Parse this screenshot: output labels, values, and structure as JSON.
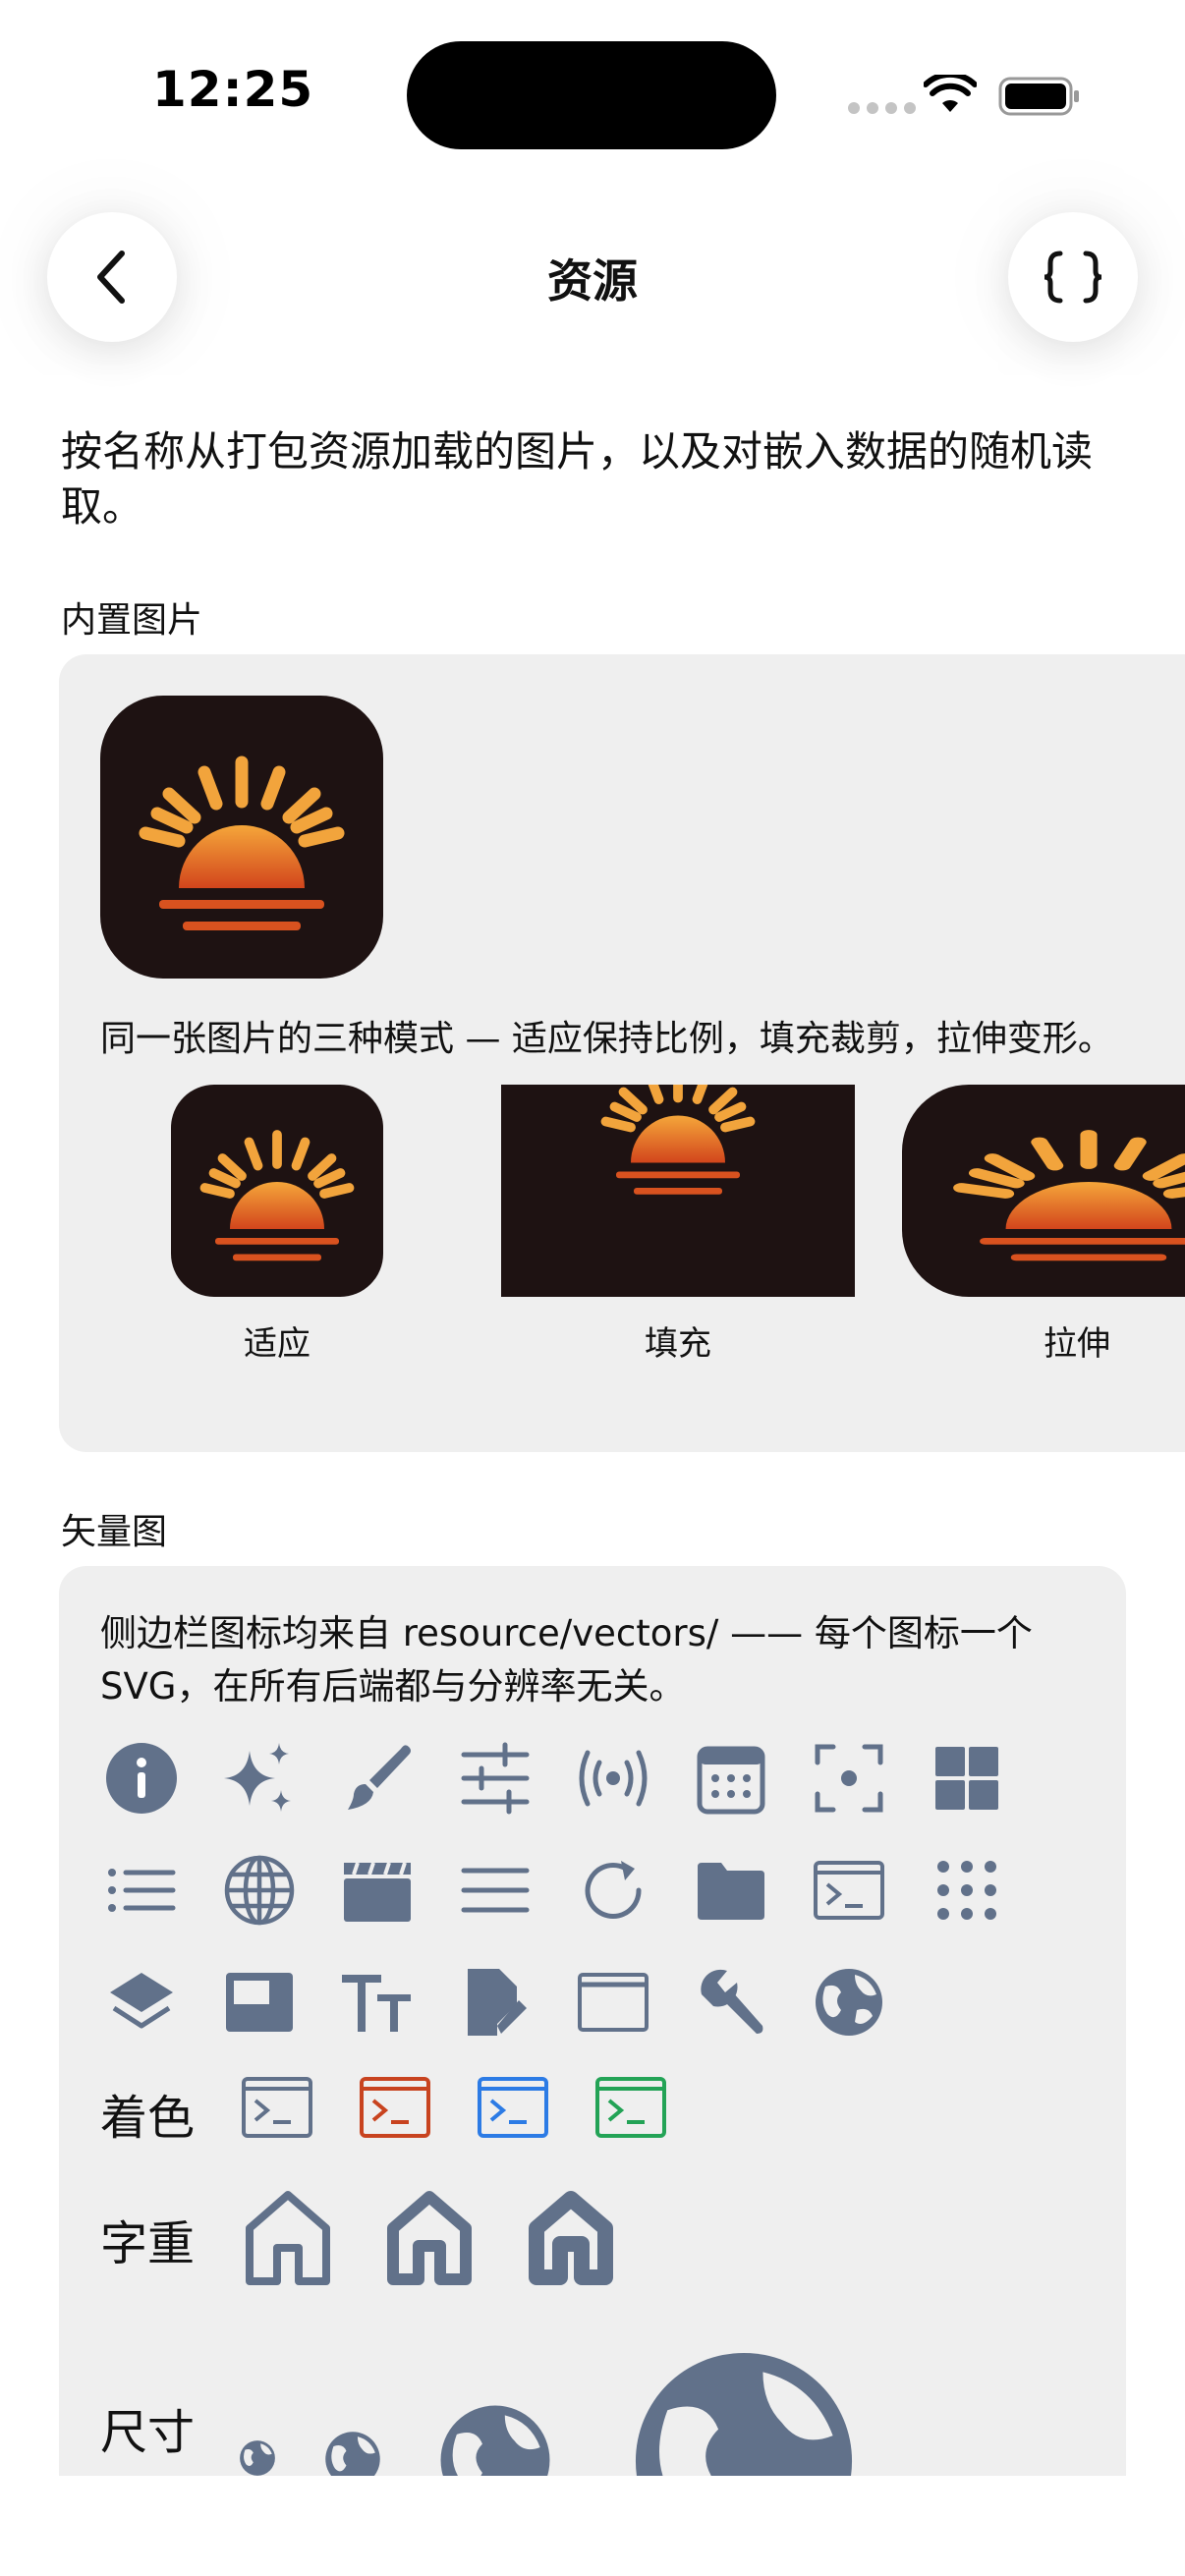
{
  "status_bar": {
    "time": "12:25"
  },
  "nav": {
    "title": "资源"
  },
  "intro": "按名称从打包资源加载的图片，以及对嵌入数据的随机读取。",
  "builtin": {
    "section_label": "内置图片",
    "modes_caption": "同一张图片的三种模式 — 适应保持比例，填充裁剪，拉伸变形。",
    "modes": [
      {
        "label": "适应"
      },
      {
        "label": "填充"
      },
      {
        "label": "拉伸"
      }
    ]
  },
  "vectors": {
    "section_label": "矢量图",
    "caption": "侧边栏图标均来自 resource/vectors/ —— 每个图标一个 SVG，在所有后端都与分辨率无关。",
    "icon_rows": [
      [
        "info-icon",
        "sparkles-icon",
        "paintbrush-icon",
        "sliders-icon",
        "broadcast-icon",
        "calendar-icon",
        "viewfinder-icon",
        "grid-icon"
      ],
      [
        "list-icon",
        "globe-icon",
        "clapperboard-icon",
        "menu-icon",
        "refresh-icon",
        "folder-icon",
        "terminal-icon",
        "dots-grid-icon"
      ],
      [
        "layers-icon",
        "window-panel-icon",
        "text-size-icon",
        "doc-edit-icon",
        "window-icon",
        "wrench-icon",
        "earth-icon"
      ]
    ],
    "tint": {
      "label": "着色",
      "colors": [
        "#61718a",
        "#c8431f",
        "#2c7be5",
        "#23a356"
      ]
    },
    "weight": {
      "label": "字重"
    },
    "size": {
      "label": "尺寸"
    }
  },
  "colors": {
    "icon_gray": "#61718a",
    "card_bg": "#efefef",
    "sun_dark": "#1e1212",
    "sun_orange": "#f0a030"
  }
}
